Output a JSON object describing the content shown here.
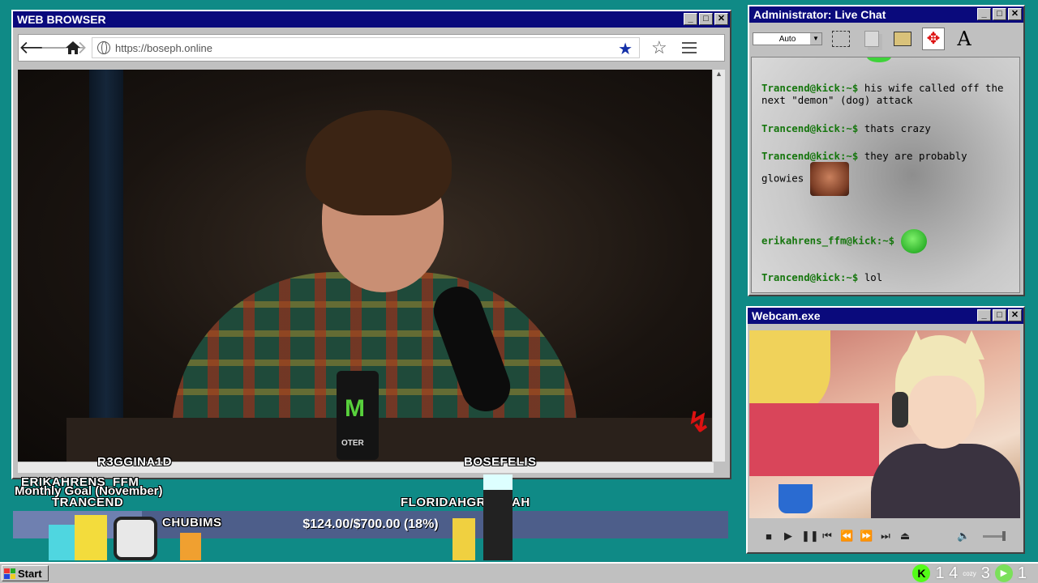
{
  "browser": {
    "title": "WEB BROWSER",
    "url": "https://boseph.online",
    "nav": {
      "back": "🡐",
      "forward": "🡒"
    },
    "video": {
      "can_text": "OTER"
    }
  },
  "chat": {
    "title": "Administrator: Live Chat",
    "font_select": "Auto",
    "font_tool": "A",
    "messages": [
      {
        "user": "Trancend@kick:~$",
        "text": "his wife called off the next \"demon\" (dog) attack"
      },
      {
        "user": "Trancend@kick:~$",
        "text": "thats crazy"
      },
      {
        "user": "Trancend@kick:~$",
        "text": "they are probably glowies",
        "emote": "laughing-face-emote"
      },
      {
        "user": "erikahrens_ffm@kick:~$",
        "text": "",
        "emote": "pepe-emote"
      },
      {
        "user": "Trancend@kick:~$",
        "text": "lol"
      }
    ]
  },
  "webcam": {
    "title": "Webcam.exe"
  },
  "window_buttons": {
    "minimize": "_",
    "maximize": "□",
    "close": "✕"
  },
  "overlay": {
    "names": [
      "R3GGINA1D",
      "BOSEFELIS",
      "ERIKAHRENS_FFM",
      "TRANCEND",
      "FLORIDAHGROYPAH",
      "CHUBIMS"
    ],
    "goal_label": "Monthly Goal (November)",
    "goal_text": "$124.00/$700.00 (18%)",
    "goal_progress": 0.18
  },
  "taskbar": {
    "start_label": "Start",
    "kick_count": "1 4",
    "cozy_label": "cozy",
    "viewer_count": "3",
    "play_count": "1"
  },
  "colors": {
    "desktop": "#0f8a86",
    "titlebar": "#0a0a7c",
    "chat_user": "#16760e",
    "goal_bar": "#4d5e8a"
  }
}
